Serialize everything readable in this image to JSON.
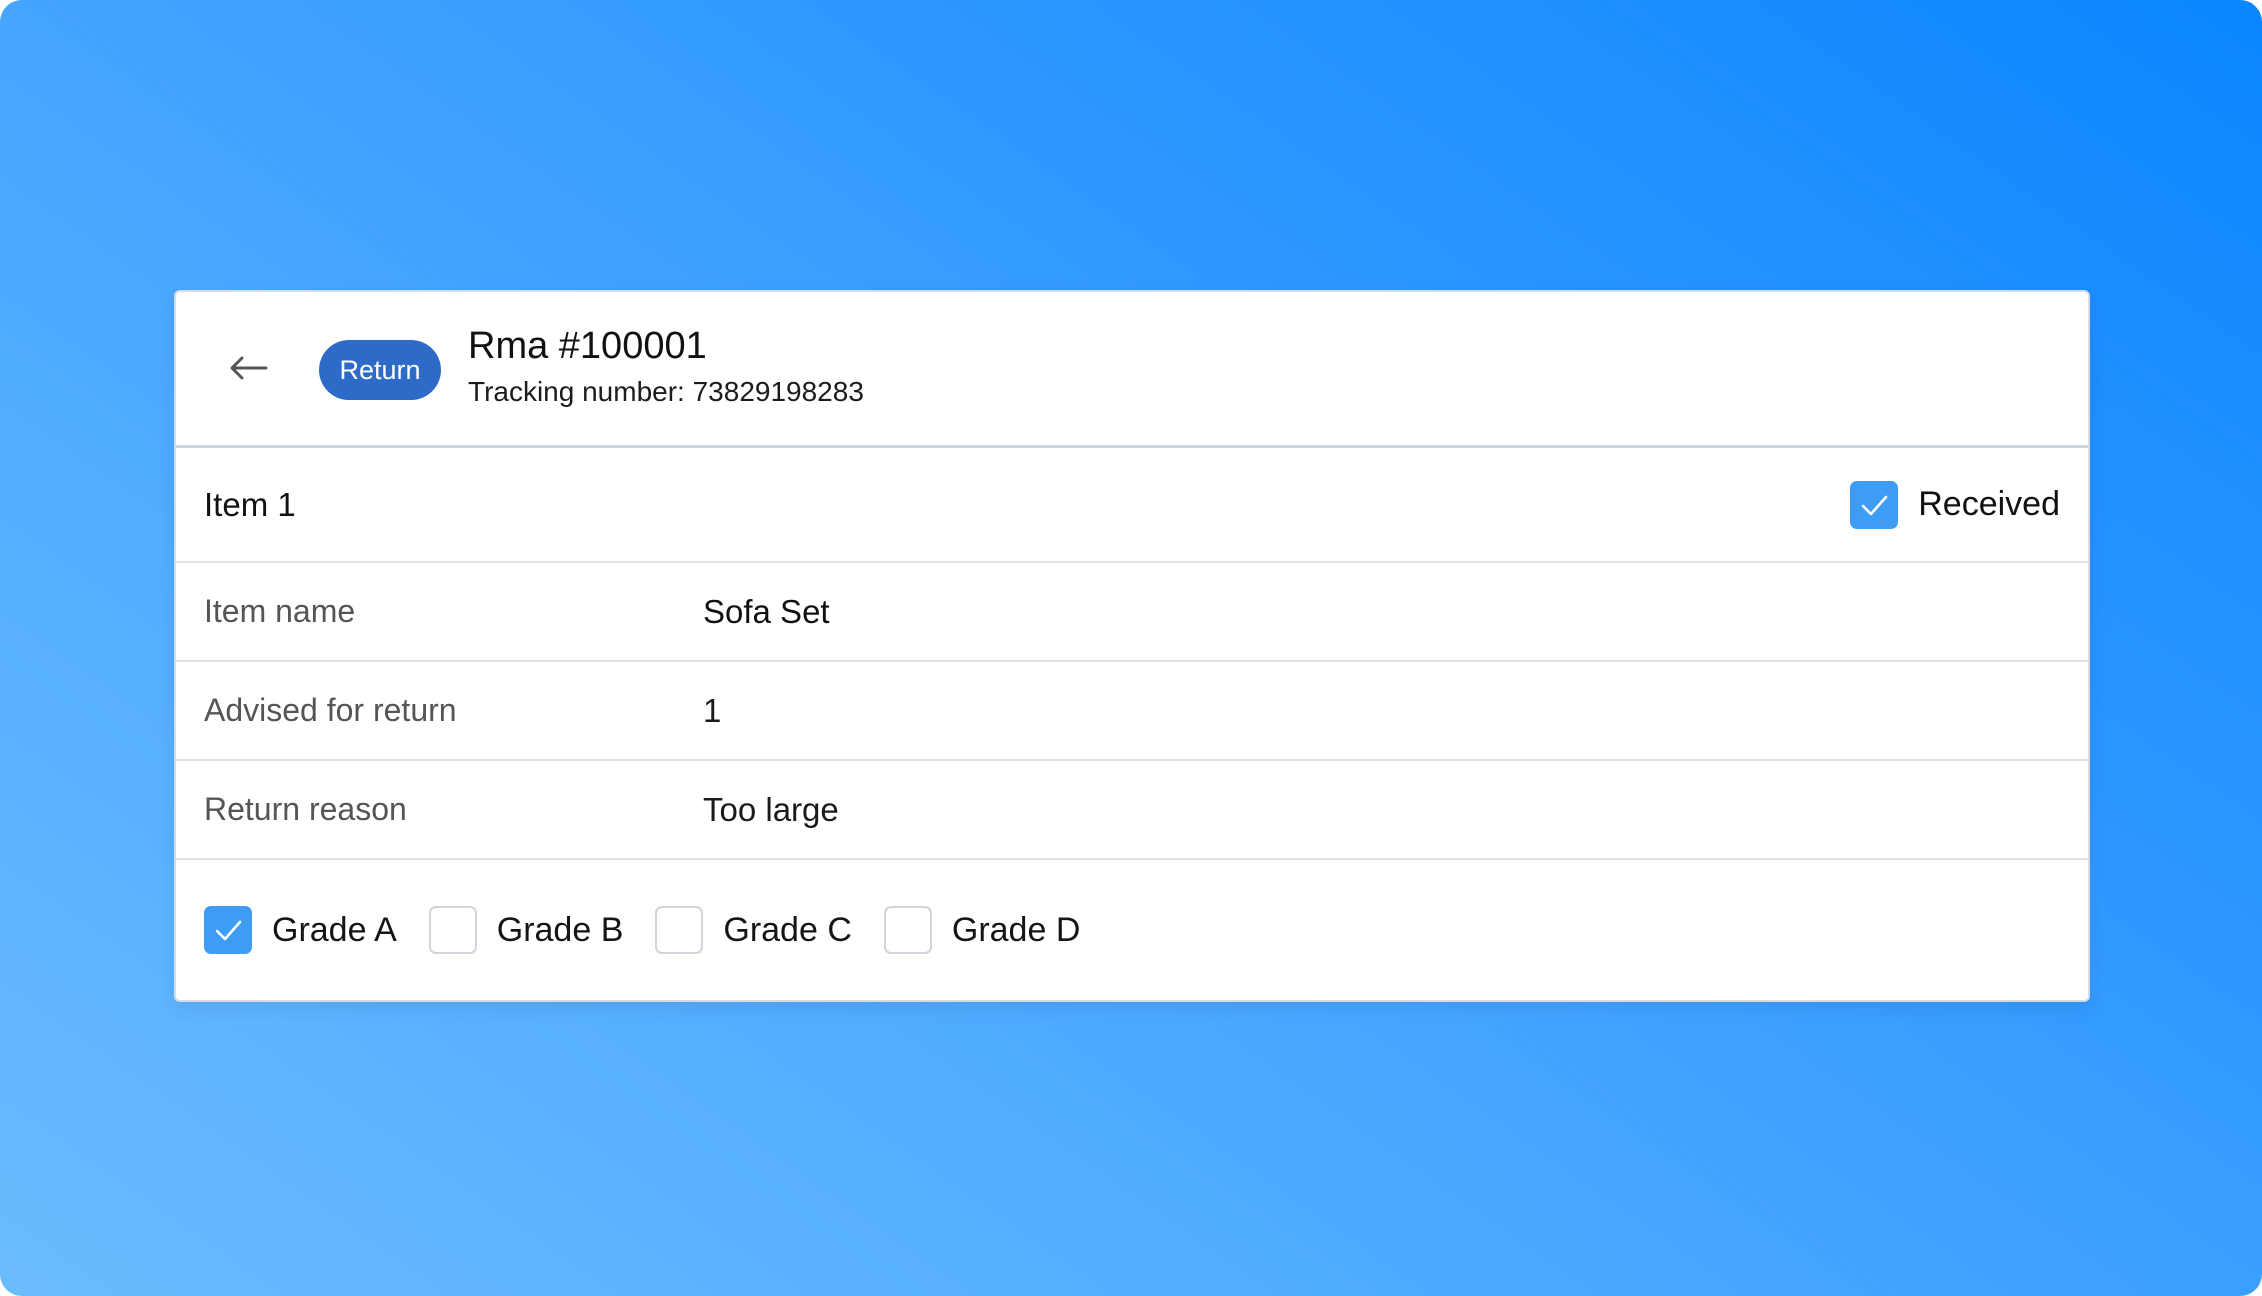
{
  "colors": {
    "accent": "#2e6bc9",
    "checkbox_checked": "#3d9cf3",
    "background_gradient_start": "#6bbcff",
    "background_gradient_end": "#0b86ff"
  },
  "header": {
    "back_icon": "arrow-left-icon",
    "badge": "Return",
    "title": "Rma #100001",
    "tracking": "Tracking number: 73829198283"
  },
  "item": {
    "title": "Item 1",
    "received_label": "Received",
    "received_checked": true
  },
  "details": [
    {
      "label": "Item name",
      "value": "Sofa Set"
    },
    {
      "label": "Advised for return",
      "value": "1"
    },
    {
      "label": "Return reason",
      "value": "Too large"
    }
  ],
  "grades": [
    {
      "label": "Grade A",
      "checked": true
    },
    {
      "label": "Grade B",
      "checked": false
    },
    {
      "label": "Grade C",
      "checked": false
    },
    {
      "label": "Grade D",
      "checked": false
    }
  ],
  "icons": {
    "check": "check-icon"
  }
}
